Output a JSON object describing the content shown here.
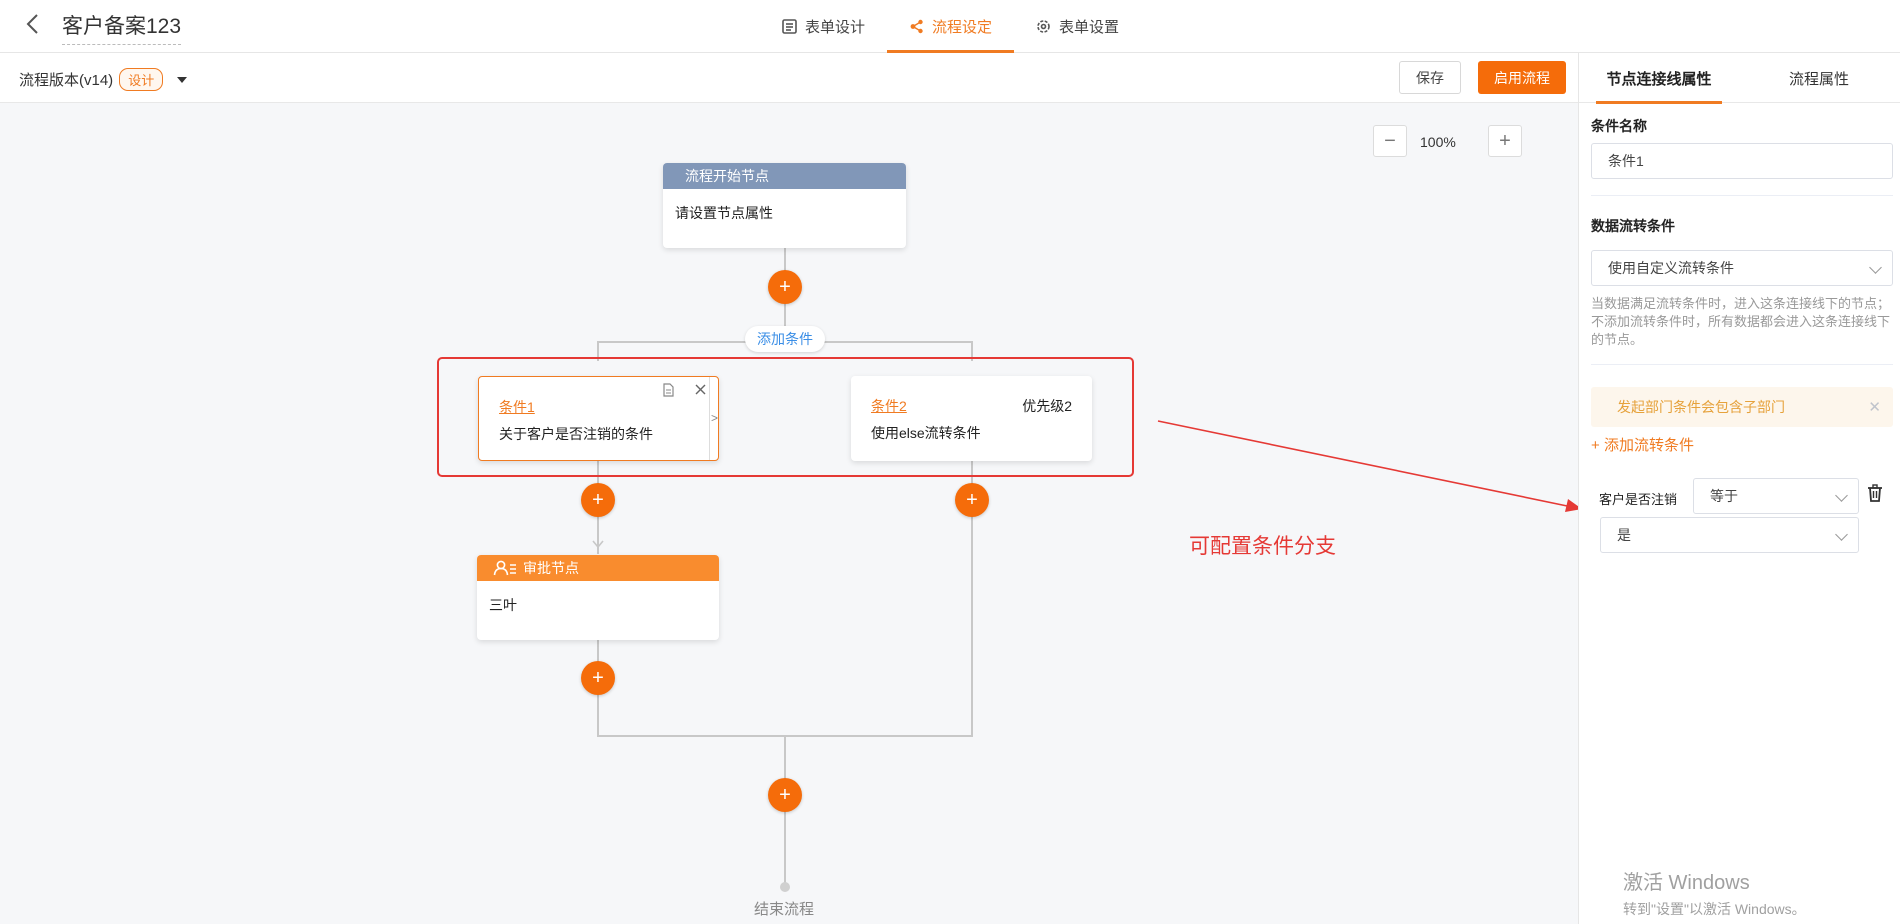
{
  "header": {
    "title": "客户备案123",
    "tabs": [
      {
        "label": "表单设计",
        "icon": "form-icon"
      },
      {
        "label": "流程设定",
        "icon": "flow-icon",
        "active": true
      },
      {
        "label": "表单设置",
        "icon": "gear-icon"
      }
    ]
  },
  "toolbar": {
    "version_label": "流程版本(v14)",
    "version_badge": "设计",
    "save_label": "保存",
    "enable_label": "启用流程"
  },
  "canvas": {
    "zoom": "100%",
    "start_node": {
      "title": "流程开始节点",
      "body": "请设置节点属性",
      "header_color": "#8197b8"
    },
    "add_condition_label": "添加条件",
    "conditions": [
      {
        "name": "条件1",
        "desc": "关于客户是否注销的条件",
        "arrow": ">"
      },
      {
        "name": "条件2",
        "desc": "使用else流转条件",
        "priority": "优先级2"
      }
    ],
    "approval_node": {
      "title": "审批节点",
      "body": "三叶",
      "header_color": "#f98c2e"
    },
    "annotation": "可配置条件分支",
    "end_label": "结束流程",
    "accent_color": "#f56c0a"
  },
  "panel": {
    "tabs": [
      "节点连接线属性",
      "流程属性"
    ],
    "condition_name_label": "条件名称",
    "condition_name_value": "条件1",
    "flow_condition_label": "数据流转条件",
    "flow_condition_value": "使用自定义流转条件",
    "hint": "当数据满足流转条件时，进入这条连接线下的节点；不添加流转条件时，所有数据都会进入这条连接线下的节点。",
    "alert": "发起部门条件会包含子部门",
    "add_rule_label": "添加流转条件",
    "rule": {
      "field": "客户是否注销",
      "operator": "等于",
      "value": "是"
    }
  },
  "watermark": {
    "line1": "激活 Windows",
    "line2": "转到\"设置\"以激活 Windows。"
  }
}
